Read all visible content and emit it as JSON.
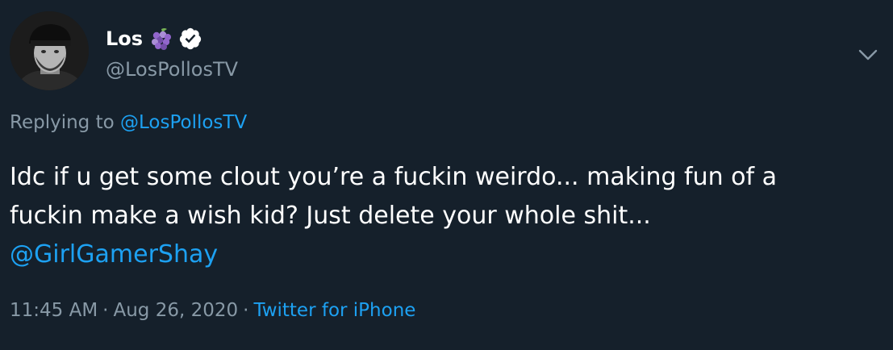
{
  "author": {
    "display_name": "Los",
    "handle": "@LosPollosTV",
    "name_emoji": "grapes-icon",
    "verified_badge": "verified-badge-icon"
  },
  "reply": {
    "prefix": "Replying to ",
    "to_handle": "@LosPollosTV"
  },
  "tweet": {
    "text_line_1": "Idc if u get some clout you’re a fuckin weirdo... making fun of a",
    "text_line_2": "fuckin make a wish kid? Just delete your whole shit...",
    "mention": "@GirlGamerShay"
  },
  "meta": {
    "time": "11:45 AM",
    "separator": "·",
    "date": "Aug 26, 2020",
    "source": "Twitter for iPhone"
  },
  "icons": {
    "menu": "chevron-down-icon"
  },
  "colors": {
    "background": "#15202b",
    "text": "#ffffff",
    "secondary_text": "#8899a6",
    "link": "#1da1f2"
  }
}
